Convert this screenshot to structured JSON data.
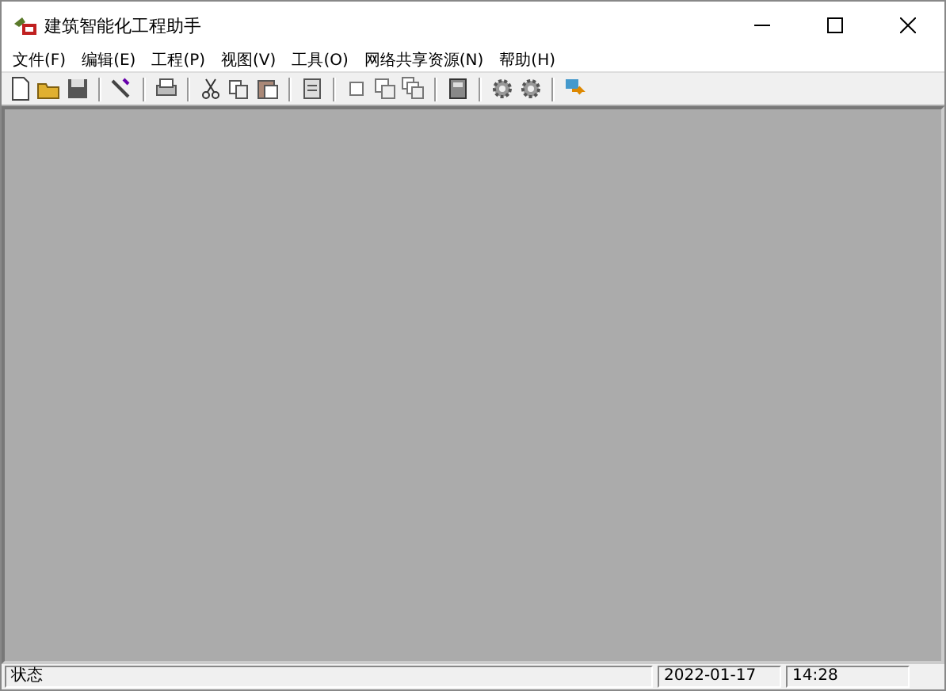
{
  "window": {
    "title": "建筑智能化工程助手"
  },
  "menu": [
    "文件(F)",
    "编辑(E)",
    "工程(P)",
    "视图(V)",
    "工具(O)",
    "网络共享资源(N)",
    "帮助(H)"
  ],
  "status_bar": [
    "状态",
    "2022-01-17",
    "14:28"
  ]
}
